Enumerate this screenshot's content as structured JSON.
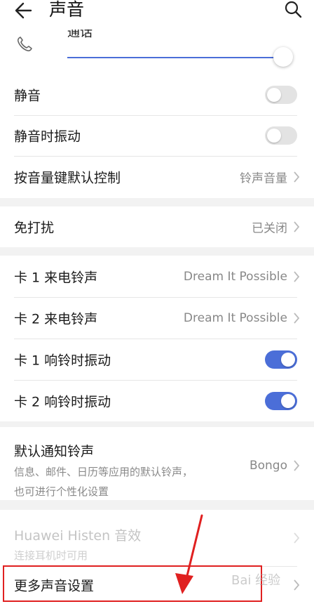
{
  "header": {
    "title": "声音",
    "back_icon": "arrow-left-icon",
    "search_icon": "search-icon"
  },
  "volume": {
    "label": "通话",
    "icon": "phone-icon",
    "level": 0.95
  },
  "group1": {
    "mute": {
      "label": "静音",
      "on": false
    },
    "mute_vibrate": {
      "label": "静音时振动",
      "on": false
    },
    "volume_key": {
      "label": "按音量键默认控制",
      "value": "铃声音量"
    }
  },
  "group2": {
    "dnd": {
      "label": "免打扰",
      "value": "已关闭"
    }
  },
  "group3": {
    "sim1_ringtone": {
      "label": "卡 1 来电铃声",
      "value": "Dream It Possible"
    },
    "sim2_ringtone": {
      "label": "卡 2 来电铃声",
      "value": "Dream It Possible"
    },
    "sim1_vibrate": {
      "label": "卡 1 响铃时振动",
      "on": true
    },
    "sim2_vibrate": {
      "label": "卡 2 响铃时振动",
      "on": true
    }
  },
  "group4": {
    "notification": {
      "label": "默认通知铃声",
      "desc_line1": "信息、邮件、日历等应用的默认铃声，",
      "desc_line2": "也可进行个性化设置",
      "value": "Bongo"
    }
  },
  "group5": {
    "histen": {
      "label": "Huawei Histen 音效",
      "desc": "连接耳机时可用"
    },
    "more": {
      "label": "更多声音设置"
    }
  },
  "colors": {
    "accent": "#4b6ed8",
    "highlight": "#e02020"
  },
  "watermark": "Bai 经验"
}
